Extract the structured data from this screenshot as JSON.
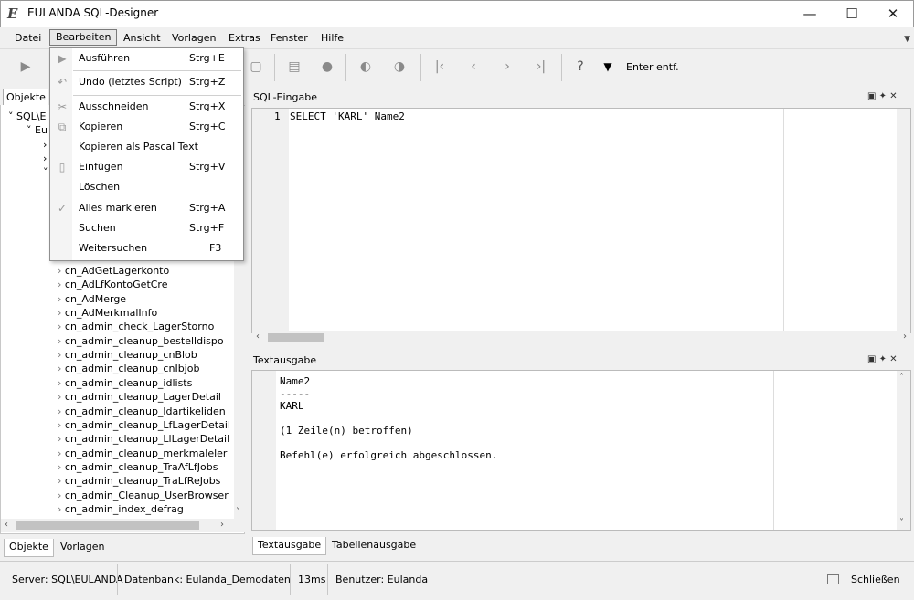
{
  "window": {
    "title": "EULANDA SQL-Designer",
    "logo_glyph": "E",
    "min": "—",
    "max": "☐",
    "close": "✕"
  },
  "menubar": {
    "items": [
      "Datei",
      "Bearbeiten",
      "Ansicht",
      "Vorlagen",
      "Extras",
      "Fenster",
      "Hilfe"
    ],
    "active": "Bearbeiten"
  },
  "toolbar": {
    "enter_entf": "Enter entf."
  },
  "edit_menu": {
    "items": [
      {
        "icon": "play-icon",
        "label": "Ausführen",
        "shortcut": "Strg+E"
      },
      {
        "icon": "undo-icon",
        "label": "Undo (letztes Script)",
        "shortcut": "Strg+Z"
      },
      {
        "icon": "scissors-icon",
        "label": "Ausschneiden",
        "shortcut": "Strg+X"
      },
      {
        "icon": "copy-icon",
        "label": "Kopieren",
        "shortcut": "Strg+C"
      },
      {
        "icon": "",
        "label": "Kopieren als Pascal Text",
        "shortcut": ""
      },
      {
        "icon": "paste-icon",
        "label": "Einfügen",
        "shortcut": "Strg+V"
      },
      {
        "icon": "",
        "label": "Löschen",
        "shortcut": ""
      },
      {
        "icon": "select-all-icon",
        "label": "Alles markieren",
        "shortcut": "Strg+A"
      },
      {
        "icon": "",
        "label": "Suchen",
        "shortcut": "Strg+F"
      },
      {
        "icon": "",
        "label": "Weitersuchen",
        "shortcut": "F3"
      }
    ]
  },
  "left_panel": {
    "tab": "Objekte",
    "tree_top": [
      "SQL\\E",
      "Eu"
    ],
    "tree_items": [
      "cn_AdGetLagerkonto",
      "cn_AdLfKontoGetCre",
      "cn_AdMerge",
      "cn_AdMerkmalInfo",
      "cn_admin_check_LagerStorno",
      "cn_admin_cleanup_bestelldispo",
      "cn_admin_cleanup_cnBlob",
      "cn_admin_cleanup_cnIbjob",
      "cn_admin_cleanup_idlists",
      "cn_admin_cleanup_LagerDetail",
      "cn_admin_cleanup_ldartikeliden",
      "cn_admin_cleanup_LfLagerDetail",
      "cn_admin_cleanup_LlLagerDetail",
      "cn_admin_cleanup_merkmaleler",
      "cn_admin_cleanup_TraAfLfJobs",
      "cn_admin_cleanup_TraLfReJobs",
      "cn_admin_Cleanup_UserBrowser",
      "cn_admin_index_defrag"
    ],
    "bottom_tabs": [
      "Objekte",
      "Vorlagen"
    ]
  },
  "sql_panel": {
    "title": "SQL-Eingabe",
    "line_no": "1",
    "code": "SELECT 'KARL' Name2"
  },
  "text_panel": {
    "title": "Textausgabe",
    "lines": [
      "Name2",
      "-----",
      "KARL",
      "",
      "(1 Zeile(n) betroffen)",
      "",
      "Befehl(e) erfolgreich abgeschlossen."
    ],
    "bottom_tabs": [
      "Textausgabe",
      "Tabellenausgabe"
    ]
  },
  "statusbar": {
    "server": "Server: SQL\\EULANDA",
    "database": "Datenbank: Eulanda_Demodaten",
    "time": "13ms",
    "user": "Benutzer: Eulanda",
    "close_label": "Schließen"
  }
}
